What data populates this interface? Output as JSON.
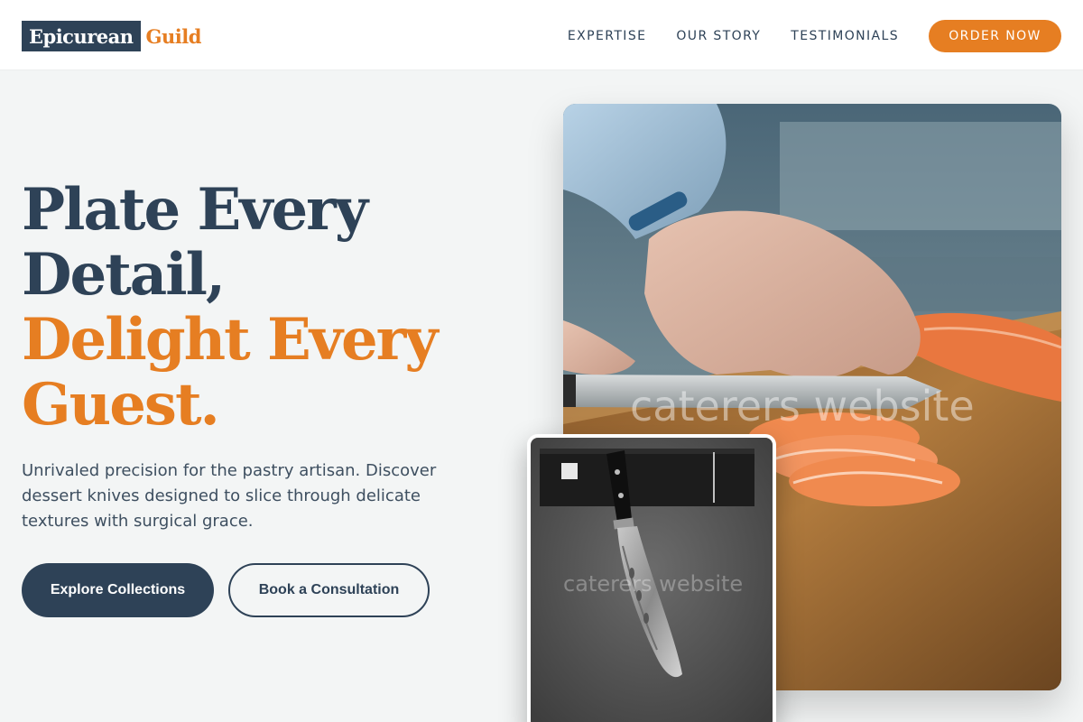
{
  "brand": {
    "name": "Epicurean",
    "accent": "Guild",
    "colors": {
      "navy": "#2e4257",
      "orange": "#e67e22",
      "background": "#f3f5f5"
    }
  },
  "nav": {
    "links": [
      "EXPERTISE",
      "OUR STORY",
      "TESTIMONIALS"
    ],
    "cta": "ORDER NOW"
  },
  "hero": {
    "title_line1": "Plate Every",
    "title_line2": "Detail,",
    "title_line3": "Delight Every",
    "title_line4": "Guest.",
    "subtitle": "Unrivaled precision for the pastry artisan. Discover dessert knives designed to slice through delicate textures with surgical grace.",
    "primary_button": "Explore Collections",
    "secondary_button": "Book a Consultation"
  },
  "images": {
    "main_watermark": "caterers website",
    "inset_watermark": "caterers website"
  }
}
